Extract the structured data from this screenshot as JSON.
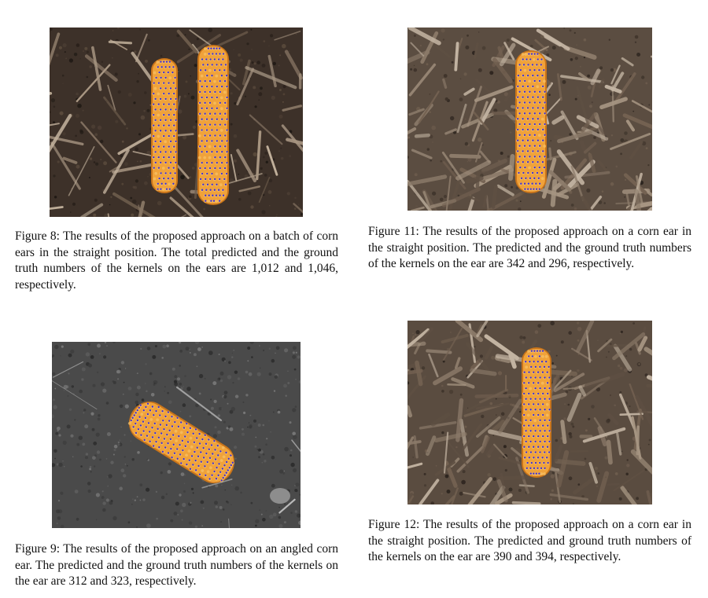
{
  "figures": [
    {
      "id": "fig8",
      "caption": "Figure 8: The results of the proposed approach on a batch of corn ears in the straight position. The total predicted and the ground truth numbers of the kernels on the ears are 1,012 and 1,046, respectively."
    },
    {
      "id": "fig9",
      "caption": "Figure 9: The results of the proposed approach on an angled corn ear. The predicted and the ground truth numbers of the kernels on the ear are 312 and 323, respectively."
    },
    {
      "id": "fig11",
      "caption": "Figure 11: The results of the proposed approach on a corn ear in the straight position. The predicted and the ground truth numbers of the kernels on the ear are 342 and 296, respectively."
    },
    {
      "id": "fig12",
      "caption": "Figure 12: The results of the proposed approach on a corn ear in the straight position. The predicted and ground truth numbers of the kernels on the ear are 390 and 394, respectively."
    }
  ],
  "colors": {
    "kernel": "#f0a23a",
    "kernel_dark": "#c9741a",
    "prediction_dot": "#3a2bd6",
    "soil_dark": "#3a2f27",
    "mulch": "#6a5a4c"
  }
}
